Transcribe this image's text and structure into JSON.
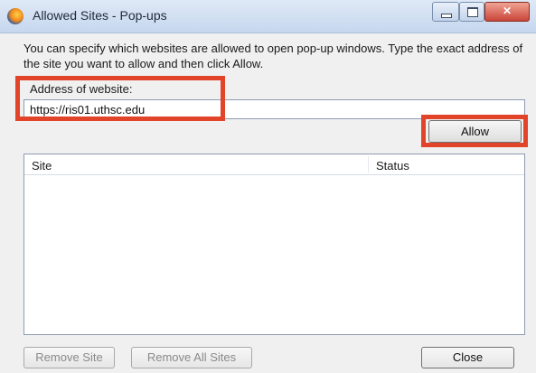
{
  "window": {
    "title": "Allowed Sites - Pop-ups",
    "icon": "firefox-icon",
    "controls": {
      "minimize": "minimize-icon",
      "maximize": "maximize-icon",
      "close": "✕"
    }
  },
  "instructions": "You can specify which websites are allowed to open pop-up windows. Type the exact address of the site you want to allow and then click Allow.",
  "address": {
    "label": "Address of website:",
    "value": "https://ris01.uthsc.edu"
  },
  "allow_label": "Allow",
  "site_list": {
    "columns": [
      "Site",
      "Status"
    ],
    "rows": []
  },
  "buttons": {
    "remove_site": "Remove Site",
    "remove_all_sites": "Remove All Sites",
    "close": "Close"
  },
  "highlight_color": "#e2442a"
}
